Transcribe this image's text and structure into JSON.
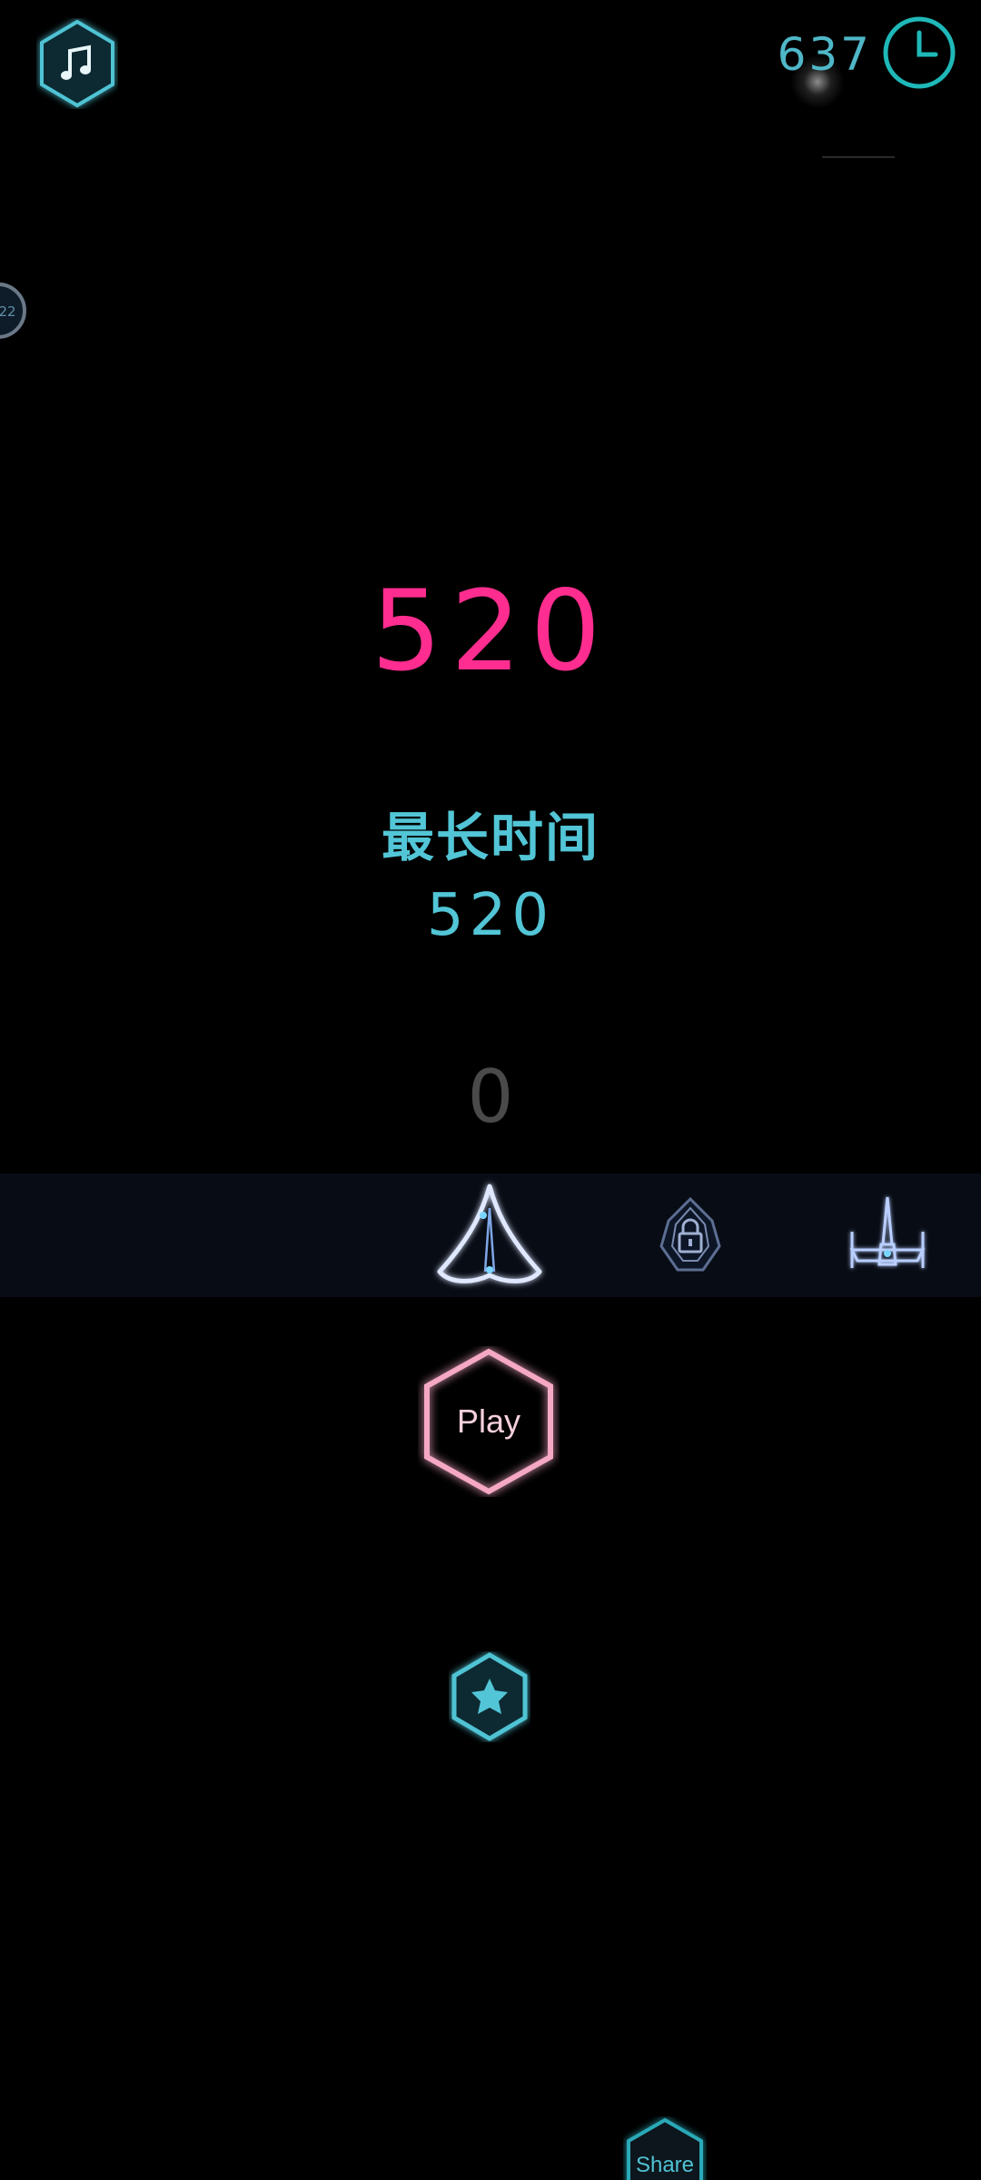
{
  "header": {
    "music_icon": "music-note-icon",
    "coins": "637",
    "timer_icon": "clock-icon",
    "side_badge_text": "22"
  },
  "score": {
    "current": "520",
    "best_label": "最长时间",
    "best_value": "520",
    "counter": "0"
  },
  "ships": [
    {
      "name": "delta-wing-ship",
      "locked": false,
      "selected": true
    },
    {
      "name": "pod-ship",
      "locked": true,
      "selected": false
    },
    {
      "name": "x-wing-ship",
      "locked": false,
      "selected": false
    }
  ],
  "buttons": {
    "play_label": "Play",
    "rate_icon": "star-icon",
    "share_label": "Share"
  },
  "colors": {
    "background": "#000000",
    "accent_cyan": "#52c5d6",
    "accent_pink": "#ff2d8f",
    "play_border": "#f5a8c4",
    "ship_band": "#080c15"
  }
}
